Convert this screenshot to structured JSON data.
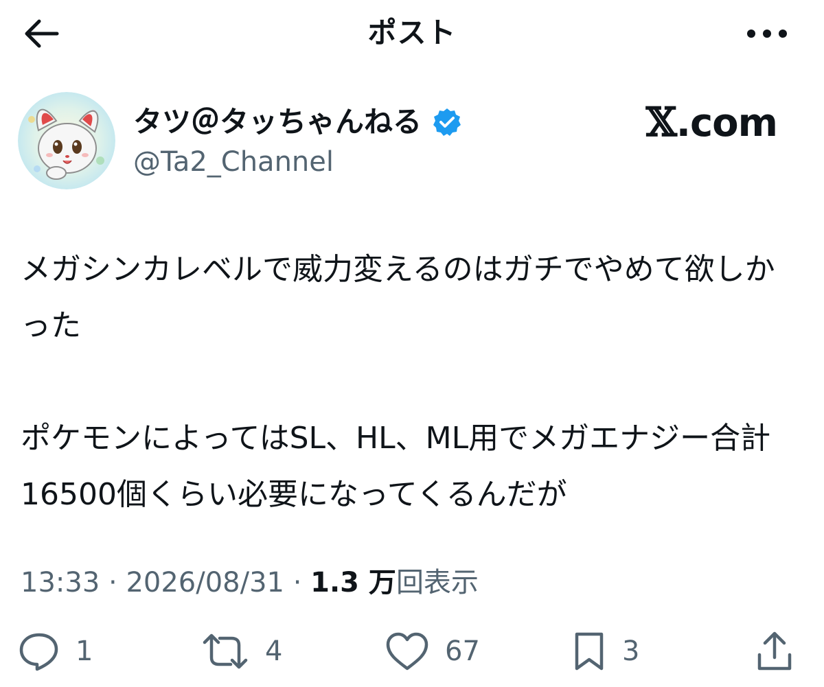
{
  "header": {
    "title": "ポスト",
    "back_icon": "arrow-left-icon",
    "more_icon": "more-horizontal-icon"
  },
  "author": {
    "display_name": "タツ＠タッちゃんねる",
    "handle": "@Ta2_Channel",
    "verified": true,
    "badge_color": "#1d9bf0"
  },
  "watermark": {
    "mark": "𝕏",
    "text": ".com"
  },
  "post": {
    "paragraphs": [
      "メガシンカレベルで威力変えるのはガチでやめて欲しかった",
      "ポケモンによってはSL、HL、ML用でメガエナジー合計16500個くらい必要になってくるんだが"
    ]
  },
  "meta": {
    "time": "13:33",
    "separator": "·",
    "date": "2026/08/31",
    "views_count": "1.3 万",
    "views_label": "回表示"
  },
  "actions": {
    "reply_count": "1",
    "repost_count": "4",
    "like_count": "67",
    "bookmark_count": "3"
  },
  "colors": {
    "text": "#0f1419",
    "secondary": "#536471",
    "accent": "#1d9bf0"
  }
}
